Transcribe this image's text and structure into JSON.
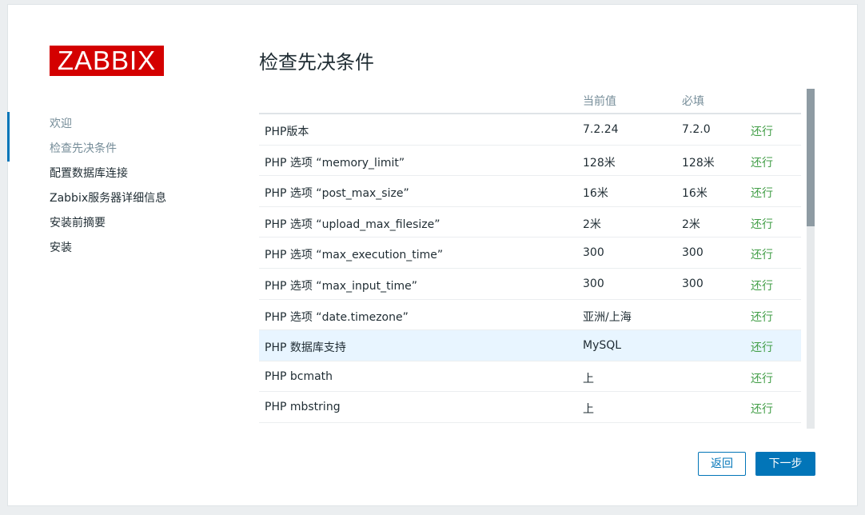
{
  "logo": {
    "text": "ZABBIX"
  },
  "sidebar": {
    "items": [
      {
        "label": "欢迎",
        "state": "done"
      },
      {
        "label": "检查先决条件",
        "state": "current"
      },
      {
        "label": "配置数据库连接",
        "state": "todo"
      },
      {
        "label": "Zabbix服务器详细信息",
        "state": "todo"
      },
      {
        "label": "安装前摘要",
        "state": "todo"
      },
      {
        "label": "安装",
        "state": "todo"
      }
    ]
  },
  "main": {
    "title": "检查先决条件",
    "table": {
      "headers": {
        "name": "",
        "current": "当前值",
        "required": "必填",
        "status": ""
      },
      "rows": [
        {
          "name": "PHP版本",
          "current": "7.2.24",
          "required": "7.2.0",
          "status": "还行"
        },
        {
          "name": "PHP 选项 “memory_limit”",
          "current": "128米",
          "required": "128米",
          "status": "还行"
        },
        {
          "name": "PHP 选项 “post_max_size”",
          "current": "16米",
          "required": "16米",
          "status": "还行"
        },
        {
          "name": "PHP 选项 “upload_max_filesize”",
          "current": "2米",
          "required": "2米",
          "status": "还行"
        },
        {
          "name": "PHP 选项 “max_execution_time”",
          "current": "300",
          "required": "300",
          "status": "还行"
        },
        {
          "name": "PHP 选项 “max_input_time”",
          "current": "300",
          "required": "300",
          "status": "还行"
        },
        {
          "name": "PHP 选项 “date.timezone”",
          "current": "亚洲/上海",
          "required": "",
          "status": "还行"
        },
        {
          "name": "PHP 数据库支持",
          "current": "MySQL",
          "required": "",
          "status": "还行"
        },
        {
          "name": "PHP bcmath",
          "current": "上",
          "required": "",
          "status": "还行"
        },
        {
          "name": "PHP mbstring",
          "current": "上",
          "required": "",
          "status": "还行"
        }
      ]
    }
  },
  "buttons": {
    "back": "返回",
    "next": "下一步"
  },
  "colors": {
    "brand": "#d40000",
    "accent": "#0275b8",
    "ok": "#429e47",
    "highlight_row": "#e8f5ff"
  }
}
